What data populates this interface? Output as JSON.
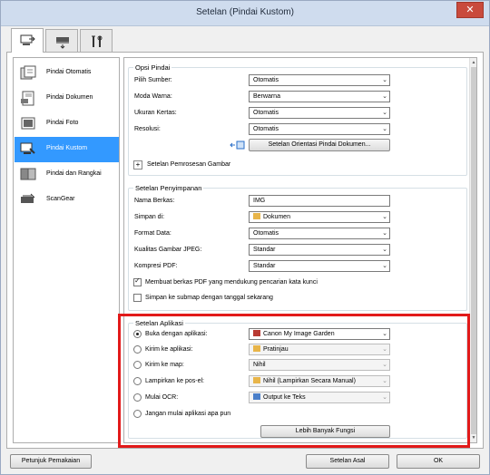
{
  "window": {
    "title": "Setelan (Pindai Kustom)",
    "close_label": "✕"
  },
  "tabs": [
    {
      "name": "scan-from-computer"
    },
    {
      "name": "scan-from-panel"
    },
    {
      "name": "general-settings"
    }
  ],
  "sidebar": {
    "items": [
      {
        "label": "Pindai Otomatis"
      },
      {
        "label": "Pindai Dokumen"
      },
      {
        "label": "Pindai Foto"
      },
      {
        "label": "Pindai Kustom"
      },
      {
        "label": "Pindai dan Rangkai"
      },
      {
        "label": "ScanGear"
      }
    ]
  },
  "scan_options": {
    "title": "Opsi Pindai",
    "source_label": "Pilih Sumber:",
    "source_value": "Otomatis",
    "color_label": "Moda Warna:",
    "color_value": "Berwarna",
    "paper_label": "Ukuran Kertas:",
    "paper_value": "Otomatis",
    "resolution_label": "Resolusi:",
    "resolution_value": "Otomatis",
    "orientation_button": "Setelan Orientasi Pindai Dokumen...",
    "image_processing": "Setelan Pemrosesan Gambar"
  },
  "save_settings": {
    "title": "Setelan Penyimpanan",
    "filename_label": "Nama Berkas:",
    "filename_value": "IMG",
    "save_in_label": "Simpan di:",
    "save_in_value": "Dokumen",
    "format_label": "Format Data:",
    "format_value": "Otomatis",
    "jpeg_label": "Kualitas Gambar JPEG:",
    "jpeg_value": "Standar",
    "pdf_label": "Kompresi PDF:",
    "pdf_value": "Standar",
    "searchable_pdf": "Membuat berkas PDF yang mendukung pencarian kata kunci",
    "subfolder": "Simpan ke submap dengan tanggal sekarang"
  },
  "app_settings": {
    "title": "Setelan Aplikasi",
    "open_with_label": "Buka dengan aplikasi:",
    "open_with_value": "Canon My Image Garden",
    "send_app_label": "Kirim ke aplikasi:",
    "send_app_value": "Pratinjau",
    "send_folder_label": "Kirim ke map:",
    "send_folder_value": "Nihil",
    "email_label": "Lampirkan ke pos-el:",
    "email_value": "Nihil (Lampirkan Secara Manual)",
    "ocr_label": "Mulai OCR:",
    "ocr_value": "Output ke Teks",
    "none_label": "Jangan mulai aplikasi apa pun",
    "more_button": "Lebih Banyak Fungsi"
  },
  "footer": {
    "help_button": "Petunjuk Pemakaian",
    "defaults_button": "Setelan Asal",
    "ok_button": "OK"
  },
  "colors": {
    "selection": "#3399ff",
    "highlight": "#e21a1a"
  }
}
